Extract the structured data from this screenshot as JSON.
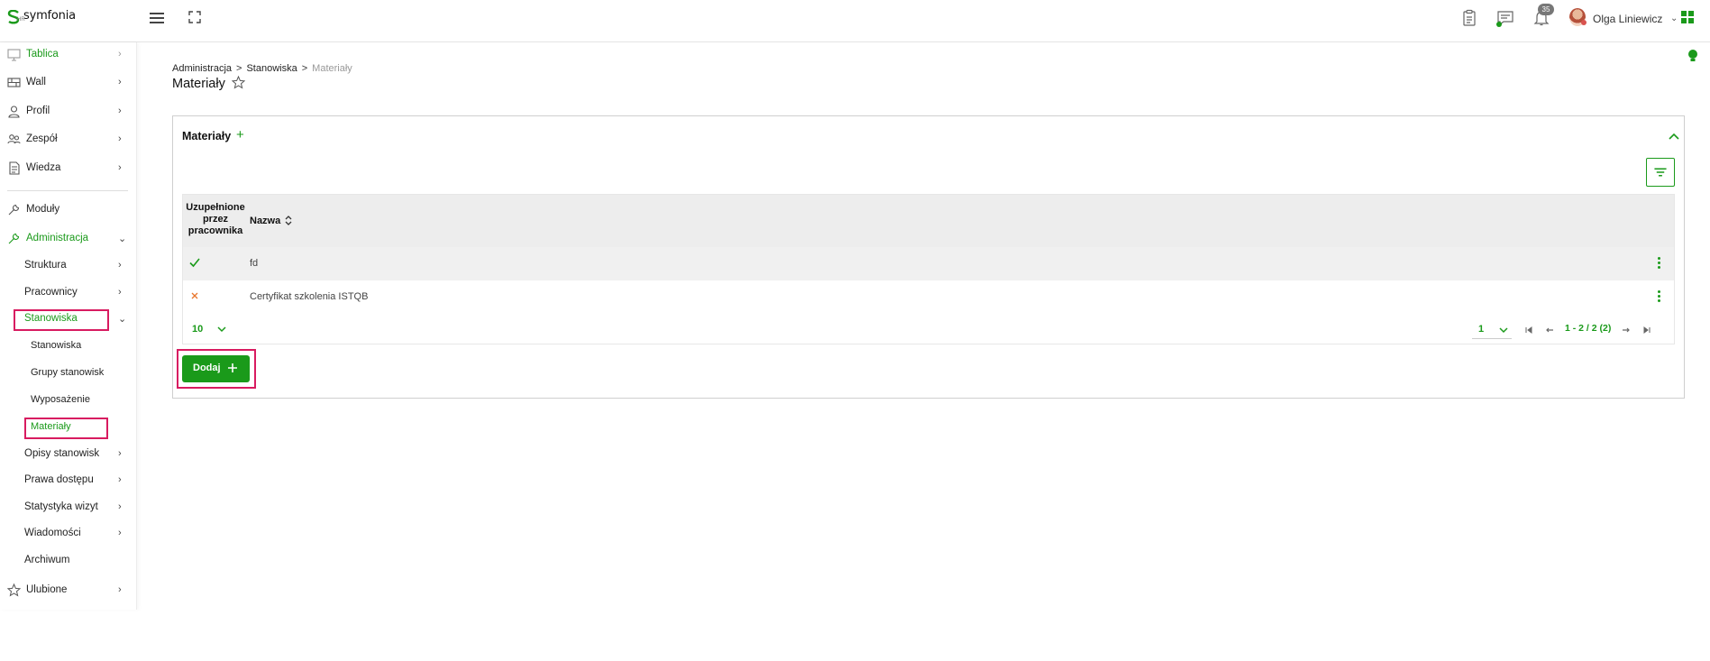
{
  "app": {
    "brand": "symfonia",
    "brand_sub": "HR"
  },
  "header": {
    "notifications_count": "35",
    "user_name": "Olga Liniewicz"
  },
  "sidebar": {
    "items": [
      {
        "label": "Tablica"
      },
      {
        "label": "Wall"
      },
      {
        "label": "Profil"
      },
      {
        "label": "Zespół"
      },
      {
        "label": "Wiedza"
      },
      {
        "label": "Moduły"
      },
      {
        "label": "Administracja"
      },
      {
        "label": "Struktura"
      },
      {
        "label": "Pracownicy"
      },
      {
        "label": "Stanowiska"
      },
      {
        "label": "Stanowiska"
      },
      {
        "label": "Grupy stanowisk"
      },
      {
        "label": "Wyposażenie"
      },
      {
        "label": "Materiały"
      },
      {
        "label": "Opisy stanowisk"
      },
      {
        "label": "Prawa dostępu"
      },
      {
        "label": "Statystyka wizyt"
      },
      {
        "label": "Wiadomości"
      },
      {
        "label": "Archiwum"
      },
      {
        "label": "Ulubione"
      }
    ]
  },
  "breadcrumb": [
    "Administracja",
    "Stanowiska",
    "Materiały"
  ],
  "page": {
    "title": "Materiały"
  },
  "panel": {
    "title": "Materiały",
    "plus": "+",
    "columns": {
      "completed": "Uzupełnione przez pracownika",
      "name": "Nazwa"
    },
    "rows": [
      {
        "completed": true,
        "name": "fd"
      },
      {
        "completed": false,
        "name": "Certyfikat szkolenia ISTQB"
      }
    ],
    "page_size": "10",
    "current_page": "1",
    "range": "1 - 2 / 2 (2)",
    "add_label": "Dodaj"
  },
  "colors": {
    "accent": "#1a9a1a",
    "highlight": "#d81b60",
    "cross": "#e8762d"
  },
  "icons": [
    "monitor-icon",
    "wall-icon",
    "user-icon",
    "team-icon",
    "document-icon",
    "wrench-icon",
    "star-icon",
    "bulb-icon",
    "filter-icon",
    "bell-icon",
    "chat-icon",
    "clipboard-icon"
  ]
}
